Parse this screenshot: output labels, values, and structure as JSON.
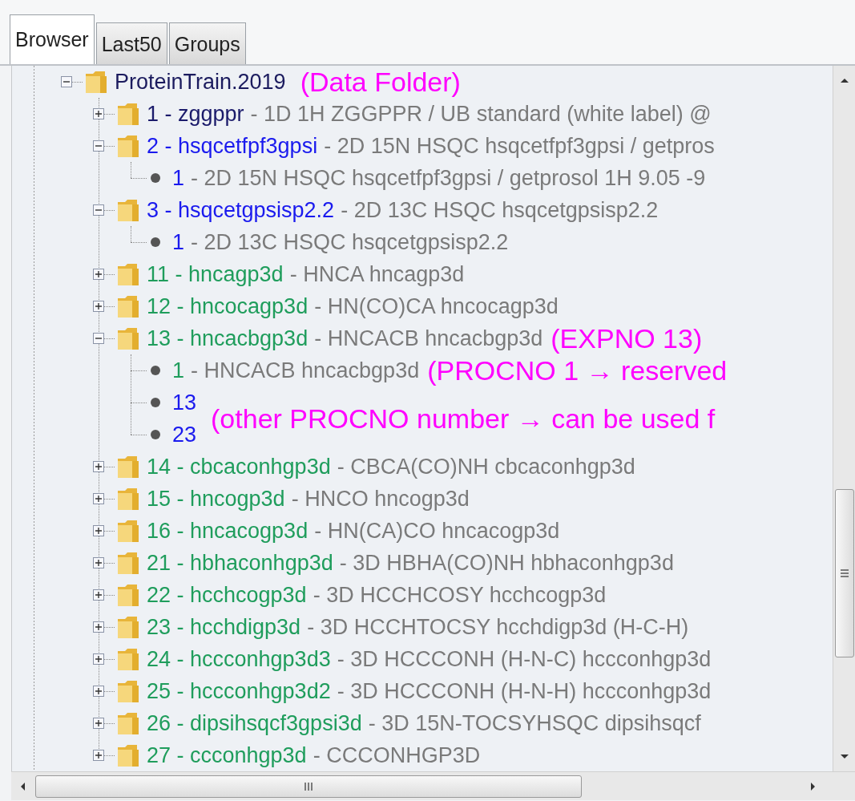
{
  "tabs": [
    {
      "label": "Browser",
      "selected": true
    },
    {
      "label": "Last50",
      "selected": false
    },
    {
      "label": "Groups",
      "selected": false
    }
  ],
  "tree": {
    "root": {
      "kind": "folder",
      "label": "ProteinTrain.2019",
      "expanded": true,
      "annotation": "(Data Folder)",
      "children": [
        {
          "kind": "folder",
          "label": "1 - zggppr",
          "description": "- 1D 1H ZGGPPR / UB standard (white label) @",
          "color": "#1b1b6b",
          "expanded": false
        },
        {
          "kind": "folder",
          "label": "2 - hsqcetfpf3gpsi",
          "description": "- 2D 15N HSQC hsqcetfpf3gpsi / getpros",
          "color": "#1a1aee",
          "expanded": true,
          "children": [
            {
              "kind": "procno",
              "label": "1",
              "description": "- 2D 15N HSQC hsqcetfpf3gpsi / getprosol 1H 9.05 -9",
              "color": "#1a1aee"
            }
          ]
        },
        {
          "kind": "folder",
          "label": "3 - hsqcetgpsisp2.2",
          "description": "- 2D 13C HSQC hsqcetgpsisp2.2",
          "color": "#1a1aee",
          "expanded": true,
          "children": [
            {
              "kind": "procno",
              "label": "1",
              "description": "- 2D 13C HSQC hsqcetgpsisp2.2",
              "color": "#1a1aee"
            }
          ]
        },
        {
          "kind": "folder",
          "label": "11 - hncagp3d",
          "description": "- HNCA hncagp3d",
          "color": "#1f9d5c",
          "expanded": false
        },
        {
          "kind": "folder",
          "label": "12 - hncocagp3d",
          "description": "- HN(CO)CA hncocagp3d",
          "color": "#1f9d5c",
          "expanded": false
        },
        {
          "kind": "folder",
          "label": "13 - hncacbgp3d",
          "description": "- HNCACB hncacbgp3d",
          "color": "#1f9d5c",
          "expanded": true,
          "annotation": "(EXPNO 13)",
          "children": [
            {
              "kind": "procno",
              "label": "1",
              "description": "- HNCACB hncacbgp3d",
              "color": "#1f9d5c",
              "annotation": "(PROCNO 1 → reserved"
            },
            {
              "kind": "procno",
              "label": "13",
              "color": "#1a1aee",
              "annotation": "(other PROCNO number → can be used f",
              "between_rows": true
            },
            {
              "kind": "procno",
              "label": "23",
              "color": "#1a1aee"
            }
          ]
        },
        {
          "kind": "folder",
          "label": "14 - cbcaconhgp3d",
          "description": "- CBCA(CO)NH cbcaconhgp3d",
          "color": "#1f9d5c",
          "expanded": false
        },
        {
          "kind": "folder",
          "label": "15 - hncogp3d",
          "description": "- HNCO hncogp3d",
          "color": "#1f9d5c",
          "expanded": false
        },
        {
          "kind": "folder",
          "label": "16 - hncacogp3d",
          "description": "- HN(CA)CO hncacogp3d",
          "color": "#1f9d5c",
          "expanded": false
        },
        {
          "kind": "folder",
          "label": "21 - hbhaconhgp3d",
          "description": "- 3D HBHA(CO)NH hbhaconhgp3d",
          "color": "#1f9d5c",
          "expanded": false
        },
        {
          "kind": "folder",
          "label": "22 - hcchcogp3d",
          "description": "- 3D HCCHCOSY hcchcogp3d",
          "color": "#1f9d5c",
          "expanded": false
        },
        {
          "kind": "folder",
          "label": "23 - hcchdigp3d",
          "description": "- 3D HCCHTOCSY hcchdigp3d (H-C-H)",
          "color": "#1f9d5c",
          "expanded": false
        },
        {
          "kind": "folder",
          "label": "24 - hccconhgp3d3",
          "description": "- 3D HCCCONH (H-N-C) hccconhgp3d",
          "color": "#1f9d5c",
          "expanded": false
        },
        {
          "kind": "folder",
          "label": "25 - hccconhgp3d2",
          "description": "- 3D HCCCONH (H-N-H) hccconhgp3d",
          "color": "#1f9d5c",
          "expanded": false
        },
        {
          "kind": "folder",
          "label": "26 - dipsihsqcf3gpsi3d",
          "description": "- 3D 15N-TOCSYHSQC dipsihsqcf",
          "color": "#1f9d5c",
          "expanded": false
        },
        {
          "kind": "folder",
          "label": "27 - ccconhgp3d",
          "description": "- CCCONHGP3D",
          "color": "#1f9d5c",
          "expanded": false
        }
      ]
    }
  }
}
